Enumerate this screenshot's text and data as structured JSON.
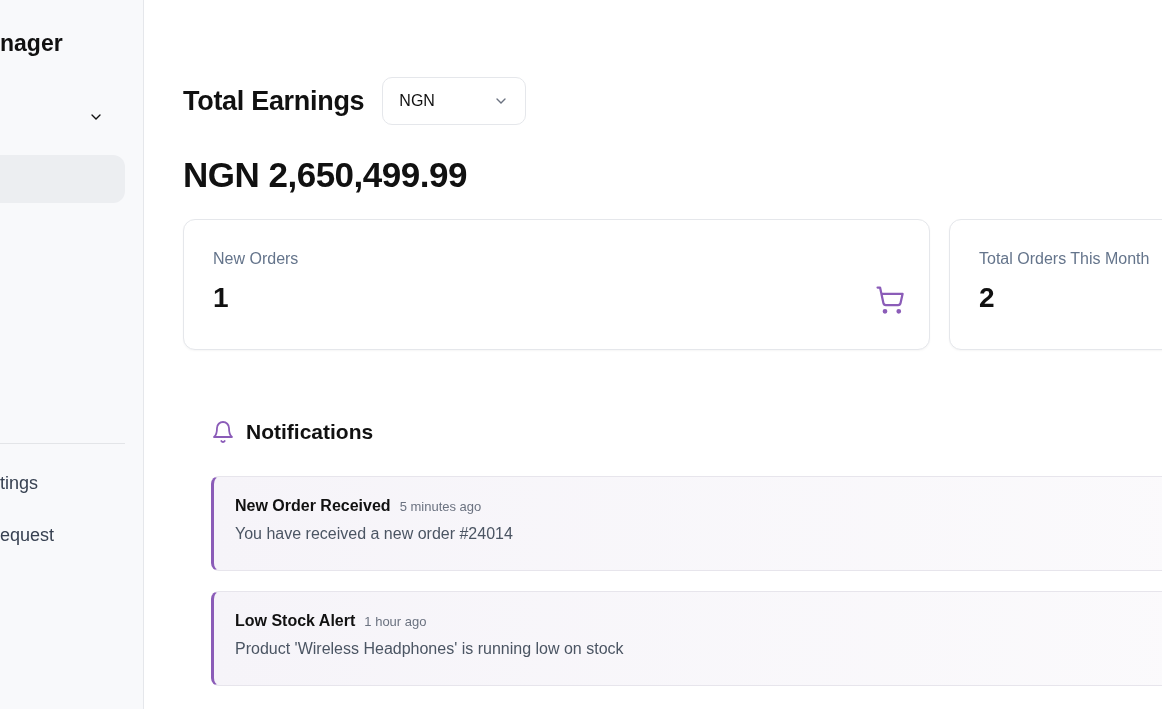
{
  "sidebar": {
    "title": "nager",
    "menu": [
      {
        "kind": "dropdown",
        "expanded": false
      },
      {
        "kind": "item",
        "selected": true
      }
    ],
    "footer_items": [
      {
        "label": "tings"
      },
      {
        "label": "equest"
      }
    ]
  },
  "earnings": {
    "title": "Total Earnings",
    "currency_select": {
      "value": "NGN"
    },
    "amount": "NGN 2,650,499.99"
  },
  "stats": [
    {
      "label": "New Orders",
      "value": "1",
      "kind": "cart"
    },
    {
      "label": "Total Orders This Month",
      "value": "2",
      "kind": "plain"
    }
  ],
  "notifications": {
    "title": "Notifications",
    "items": [
      {
        "title": "New Order Received",
        "time": "5 minutes ago",
        "message": "You have received a new order #24014"
      },
      {
        "title": "Low Stock Alert",
        "time": "1 hour ago",
        "message": "Product 'Wireless Headphones' is running low on stock"
      }
    ]
  }
}
